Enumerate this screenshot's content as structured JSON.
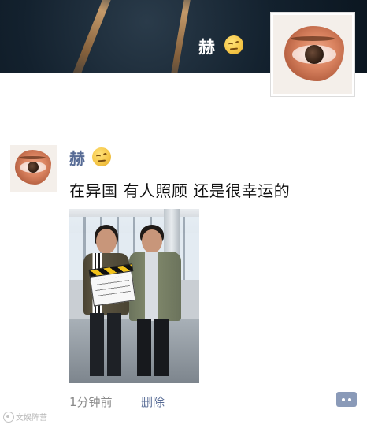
{
  "cover": {
    "user_name": "赫",
    "emoji_icon": "raised-eyebrow-face-icon"
  },
  "post": {
    "author_name": "赫",
    "author_emoji_icon": "raised-eyebrow-face-icon",
    "text": "在异国 有人照顾 还是很幸运的",
    "time": "1分钟前",
    "delete_label": "删除",
    "comment_icon": "comment-more-icon"
  },
  "watermark": {
    "text": "文娱阵营"
  },
  "colors": {
    "link_blue": "#576b95",
    "time_gray": "#8a8a8a",
    "comment_button_bg": "#8a9ab8"
  }
}
